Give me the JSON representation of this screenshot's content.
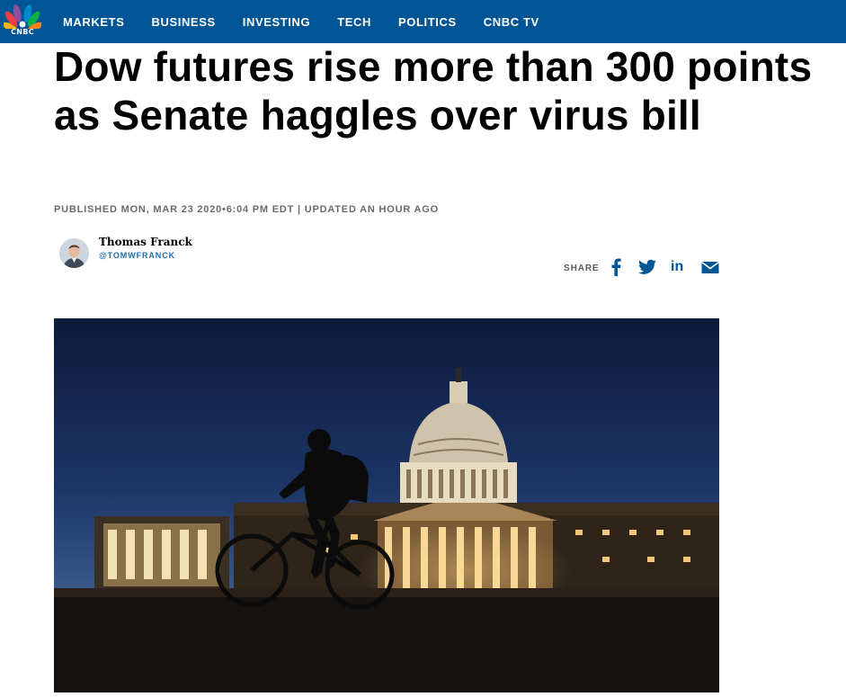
{
  "brand": {
    "logo_text": "CNBC"
  },
  "nav": {
    "items": [
      "MARKETS",
      "BUSINESS",
      "INVESTING",
      "TECH",
      "POLITICS",
      "CNBC TV"
    ]
  },
  "article": {
    "headline": "Dow futures rise more than 300 points as Senate haggles over virus bill",
    "meta": "PUBLISHED MON, MAR 23 2020•6:04 PM EDT | UPDATED AN HOUR AGO",
    "author": {
      "name": "Thomas Franck",
      "handle": "@TOMWFRANCK"
    }
  },
  "share": {
    "label": "SHARE",
    "icons": [
      "facebook-icon",
      "twitter-icon",
      "linkedin-icon",
      "email-icon"
    ],
    "linkedin_text": "in"
  },
  "colors": {
    "nav_bg": "#005594",
    "icon_blue": "#005594",
    "handle_blue": "#1b6fa8"
  }
}
